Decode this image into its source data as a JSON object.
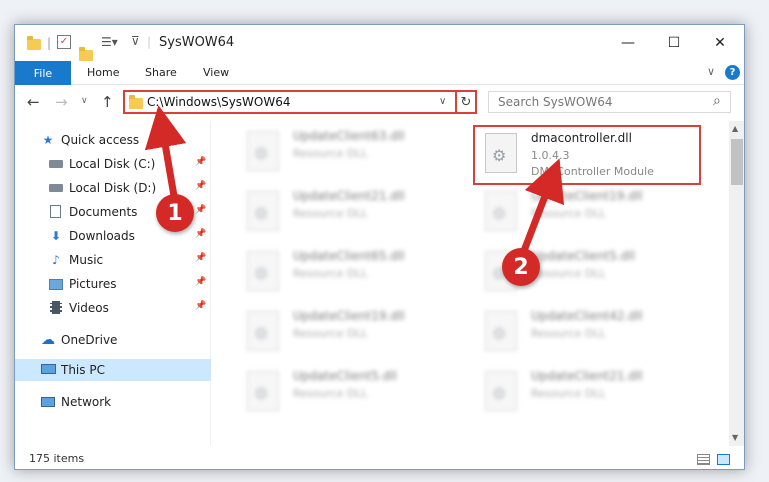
{
  "window": {
    "title": "SysWOW64",
    "minimize": "—",
    "maximize": "☐",
    "close": "✕"
  },
  "ribbon": {
    "file": "File",
    "home": "Home",
    "share": "Share",
    "view": "View",
    "expand": "∨",
    "help": "?"
  },
  "nav": {
    "back": "←",
    "forward": "→",
    "recent": "∨",
    "up": "↑",
    "address": "C:\\Windows\\SysWOW64",
    "address_dropdown": "∨",
    "refresh": "↻",
    "search_placeholder": "Search SysWOW64",
    "search_icon": "⌕"
  },
  "sidebar": {
    "items": [
      {
        "label": "Quick access",
        "icon": "star-icon",
        "pinned": false
      },
      {
        "label": "Local Disk (C:)",
        "icon": "drive-icon",
        "pinned": true
      },
      {
        "label": "Local Disk (D:)",
        "icon": "drive-icon",
        "pinned": true
      },
      {
        "label": "Documents",
        "icon": "documents-icon",
        "pinned": true
      },
      {
        "label": "Downloads",
        "icon": "download-icon",
        "pinned": true
      },
      {
        "label": "Music",
        "icon": "music-icon",
        "pinned": true
      },
      {
        "label": "Pictures",
        "icon": "pictures-icon",
        "pinned": true
      },
      {
        "label": "Videos",
        "icon": "videos-icon",
        "pinned": true
      },
      {
        "label": "OneDrive",
        "icon": "cloud-icon",
        "pinned": false
      },
      {
        "label": "This PC",
        "icon": "monitor-icon",
        "pinned": false,
        "selected": true
      },
      {
        "label": "Network",
        "icon": "network-icon",
        "pinned": false
      }
    ]
  },
  "files": {
    "left": [
      {
        "name": "UpdateClient63.dll",
        "type": "Resource DLL"
      },
      {
        "name": "UpdateClient21.dll",
        "type": "Resource DLL"
      },
      {
        "name": "UpdateClient65.dll",
        "type": "Resource DLL"
      },
      {
        "name": "UpdateClient19.dll",
        "type": "Resource DLL"
      },
      {
        "name": "UpdateClient5.dll",
        "type": "Resource DLL"
      }
    ],
    "right": [
      {
        "name": "dmacontroller.dll",
        "version": "1.0.4.3",
        "type": "DMAController Module"
      },
      {
        "name": "UpdateClient19.dll",
        "type": "Resource DLL"
      },
      {
        "name": "UpdateClient5.dll",
        "type": "Resource DLL"
      },
      {
        "name": "UpdateClient42.dll",
        "type": "Resource DLL"
      },
      {
        "name": "UpdateClient21.dll",
        "type": "Resource DLL"
      }
    ]
  },
  "status": {
    "count": "175 items"
  },
  "annotations": {
    "step1": "1",
    "step2": "2"
  },
  "colors": {
    "accent": "#1979ca",
    "highlight": "#d9403a",
    "badge": "#d32a27",
    "selection": "#cce8ff"
  }
}
